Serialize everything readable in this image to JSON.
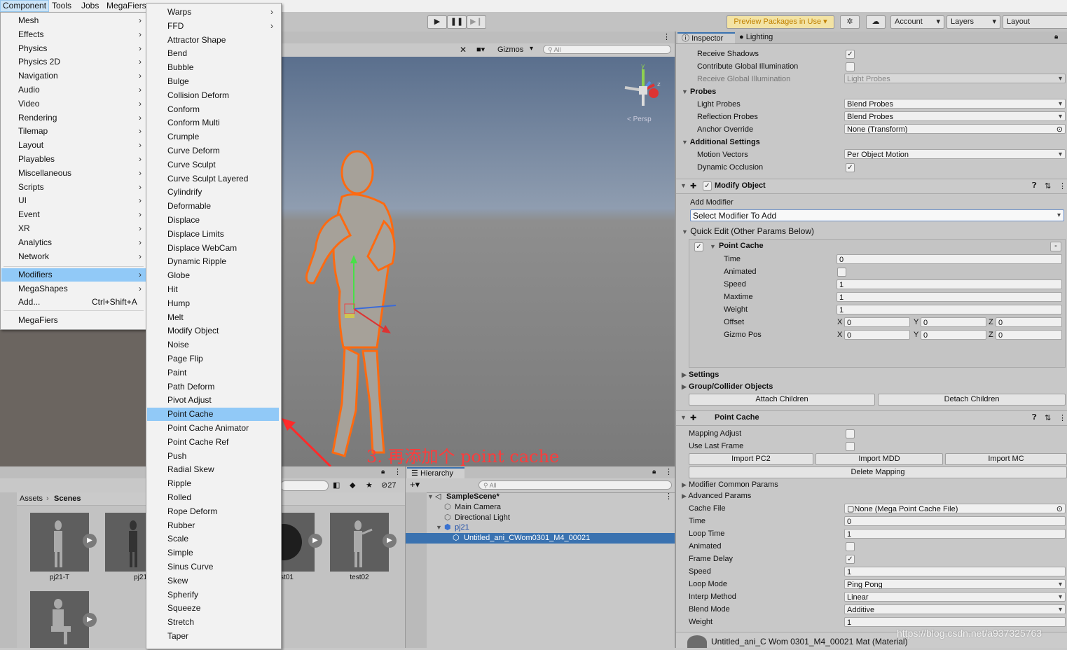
{
  "menubar": {
    "items": [
      "Component",
      "Tools",
      "Jobs",
      "MegaFiers"
    ]
  },
  "toolbar": {
    "preview_label": "Preview Packages in Use",
    "account_label": "Account",
    "layers_label": "Layers",
    "layout_label": "Layout"
  },
  "scene": {
    "gizmos_label": "Gizmos",
    "search_placeholder": "All",
    "persp_label": "< Persp",
    "annotation": "3. 再添加个 point cache"
  },
  "component_menu": {
    "items": [
      {
        "label": "Mesh"
      },
      {
        "label": "Effects"
      },
      {
        "label": "Physics"
      },
      {
        "label": "Physics 2D"
      },
      {
        "label": "Navigation"
      },
      {
        "label": "Audio"
      },
      {
        "label": "Video"
      },
      {
        "label": "Rendering"
      },
      {
        "label": "Tilemap"
      },
      {
        "label": "Layout"
      },
      {
        "label": "Playables"
      },
      {
        "label": "Miscellaneous"
      },
      {
        "label": "Scripts"
      },
      {
        "label": "UI"
      },
      {
        "label": "Event"
      },
      {
        "label": "XR"
      },
      {
        "label": "Analytics"
      },
      {
        "label": "Network"
      }
    ],
    "group2": [
      {
        "label": "Modifiers"
      },
      {
        "label": "MegaShapes"
      }
    ],
    "add_label": "Add...",
    "add_shortcut": "Ctrl+Shift+A",
    "megafiers_label": "MegaFiers"
  },
  "modifiers_menu": {
    "items": [
      "Warps",
      "FFD",
      "Attractor Shape",
      "Bend",
      "Bubble",
      "Bulge",
      "Collision Deform",
      "Conform",
      "Conform Multi",
      "Crumple",
      "Curve Deform",
      "Curve Sculpt",
      "Curve Sculpt Layered",
      "Cylindrify",
      "Deformable",
      "Displace",
      "Displace Limits",
      "Displace WebCam",
      "Dynamic Ripple",
      "Globe",
      "Hit",
      "Hump",
      "Melt",
      "Modify Object",
      "Noise",
      "Page Flip",
      "Paint",
      "Path Deform",
      "Pivot Adjust",
      "Point Cache",
      "Point Cache Animator",
      "Point Cache Ref",
      "Push",
      "Radial Skew",
      "Ripple",
      "Rolled",
      "Rope Deform",
      "Rubber",
      "Scale",
      "Simple",
      "Sinus Curve",
      "Skew",
      "Spherify",
      "Squeeze",
      "Stretch",
      "Taper"
    ],
    "highlighted": "Point Cache"
  },
  "project": {
    "breadcrumb_root": "Assets",
    "breadcrumb_current": "Scenes",
    "count": "27",
    "assets": [
      "pj21-T",
      "pj21",
      "st01",
      "test02"
    ]
  },
  "hierarchy": {
    "tab_label": "Hierarchy",
    "search_placeholder": "All",
    "rows": [
      "SampleScene*",
      "Main Camera",
      "Directional Light",
      "pj21",
      "Untitled_ani_CWom0301_M4_00021"
    ]
  },
  "inspector": {
    "tab_inspector": "Inspector",
    "tab_lighting": "Lighting",
    "receive_shadows": "Receive Shadows",
    "contribute_gi": "Contribute Global Illumination",
    "receive_gi": "Receive Global Illumination",
    "receive_gi_value": "Light Probes",
    "probes": "Probes",
    "light_probes": "Light Probes",
    "light_probes_value": "Blend Probes",
    "reflection_probes": "Reflection Probes",
    "reflection_probes_value": "Blend Probes",
    "anchor_override": "Anchor Override",
    "anchor_override_value": "None (Transform)",
    "additional_settings": "Additional Settings",
    "motion_vectors": "Motion Vectors",
    "motion_vectors_value": "Per Object Motion",
    "dynamic_occlusion": "Dynamic Occlusion",
    "modify_object_title": "Modify Object",
    "add_modifier": "Add Modifier",
    "select_modifier": "Select Modifier To Add",
    "quick_edit": "Quick Edit (Other Params Below)",
    "pc_title": "Point Cache",
    "pc_fields": [
      {
        "label": "Time",
        "value": "0"
      },
      {
        "label": "Animated",
        "value": ""
      },
      {
        "label": "Speed",
        "value": "1"
      },
      {
        "label": "Maxtime",
        "value": "1"
      },
      {
        "label": "Weight",
        "value": "1"
      }
    ],
    "offset_label": "Offset",
    "gizmo_pos_label": "Gizmo Pos",
    "offset": {
      "x": "0",
      "y": "0",
      "z": "0"
    },
    "gizmo_pos": {
      "x": "0",
      "y": "0",
      "z": "0"
    },
    "axis_x": "X",
    "axis_y": "Y",
    "axis_z": "Z",
    "settings": "Settings",
    "group_collider": "Group/Collider Objects",
    "attach_children": "Attach Children",
    "detach_children": "Detach Children",
    "point_cache_title": "Point Cache",
    "mapping_adjust": "Mapping Adjust",
    "use_last_frame": "Use Last Frame",
    "import_pc2": "Import PC2",
    "import_mdd": "Import MDD",
    "import_mc": "Import MC",
    "delete_mapping": "Delete Mapping",
    "modifier_common": "Modifier Common Params",
    "advanced_params": "Advanced Params",
    "cache_file": "Cache File",
    "cache_file_value": "None (Mega Point Cache File)",
    "time": "Time",
    "time_value": "0",
    "loop_time": "Loop Time",
    "loop_time_value": "1",
    "animated": "Animated",
    "frame_delay": "Frame Delay",
    "speed": "Speed",
    "speed_value": "1",
    "loop_mode": "Loop Mode",
    "loop_mode_value": "Ping Pong",
    "interp_method": "Interp Method",
    "interp_method_value": "Linear",
    "blend_mode": "Blend Mode",
    "blend_mode_value": "Additive",
    "weight": "Weight",
    "weight_value": "1",
    "material": "Untitled_ani_C Wom 0301_M4_00021 Mat (Material)"
  },
  "watermark": "https://blog.csdn.net/a937325763"
}
